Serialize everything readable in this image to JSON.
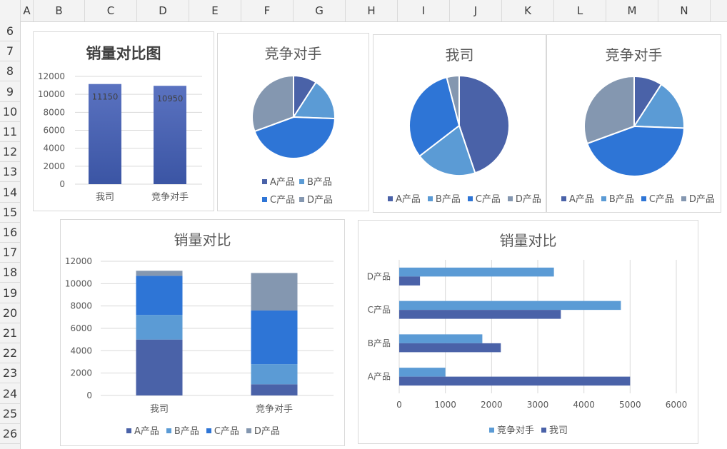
{
  "sheet": {
    "columns": [
      "A",
      "B",
      "C",
      "D",
      "E",
      "F",
      "G",
      "H",
      "I",
      "J",
      "K",
      "L",
      "M",
      "N"
    ],
    "rows": [
      "6",
      "7",
      "8",
      "9",
      "10",
      "11",
      "12",
      "13",
      "14",
      "15",
      "16",
      "17",
      "18",
      "19",
      "20",
      "21",
      "22",
      "23",
      "24",
      "25",
      "26"
    ]
  },
  "colors": {
    "A": "#4a62a8",
    "B": "#5b9bd5",
    "C": "#2e75d6",
    "D": "#8497b0",
    "grid": "#d9d9d9",
    "axis": "#bfbfbf"
  },
  "chart_data": [
    {
      "id": "total-bar",
      "type": "bar",
      "title": "销量对比图",
      "categories": [
        "我司",
        "竞争对手"
      ],
      "values": [
        11150,
        10950
      ],
      "data_labels": [
        "11150",
        "10950"
      ],
      "ylim": [
        0,
        12000
      ],
      "yticks": [
        "0",
        "2000",
        "4000",
        "6000",
        "8000",
        "10000",
        "12000"
      ],
      "grid": true
    },
    {
      "id": "pie-competitor-1",
      "type": "pie",
      "title": "竞争对手",
      "labels": [
        "A产品",
        "B产品",
        "C产品",
        "D产品"
      ],
      "values": [
        1000,
        1800,
        4800,
        3350
      ],
      "legend_position": "bottom"
    },
    {
      "id": "pie-ours",
      "type": "pie",
      "title": "我司",
      "labels": [
        "A产品",
        "B产品",
        "C产品",
        "D产品"
      ],
      "values": [
        5000,
        2200,
        3500,
        450
      ],
      "legend_position": "bottom"
    },
    {
      "id": "pie-competitor-2",
      "type": "pie",
      "title": "竞争对手",
      "labels": [
        "A产品",
        "B产品",
        "C产品",
        "D产品"
      ],
      "values": [
        1000,
        1800,
        4800,
        3350
      ],
      "legend_position": "bottom"
    },
    {
      "id": "stacked-bar",
      "type": "bar",
      "title": "销量对比",
      "categories": [
        "我司",
        "竞争对手"
      ],
      "series": [
        {
          "name": "A产品",
          "values": [
            5000,
            1000
          ]
        },
        {
          "name": "B产品",
          "values": [
            2200,
            1800
          ]
        },
        {
          "name": "C产品",
          "values": [
            3500,
            4800
          ]
        },
        {
          "name": "D产品",
          "values": [
            450,
            3350
          ]
        }
      ],
      "ylim": [
        0,
        12000
      ],
      "yticks": [
        "0",
        "2000",
        "4000",
        "6000",
        "8000",
        "10000",
        "12000"
      ],
      "stacked": true,
      "grid": true,
      "legend_position": "bottom"
    },
    {
      "id": "hbar",
      "type": "bar",
      "orientation": "horizontal",
      "title": "销量对比",
      "categories": [
        "A产品",
        "B产品",
        "C产品",
        "D产品"
      ],
      "series": [
        {
          "name": "竞争对手",
          "values": [
            1000,
            1800,
            4800,
            3350
          ]
        },
        {
          "name": "我司",
          "values": [
            5000,
            2200,
            3500,
            450
          ]
        }
      ],
      "xlim": [
        0,
        6000
      ],
      "xticks": [
        "0",
        "1000",
        "2000",
        "3000",
        "4000",
        "5000",
        "6000"
      ],
      "grid": true,
      "legend_position": "bottom"
    }
  ]
}
